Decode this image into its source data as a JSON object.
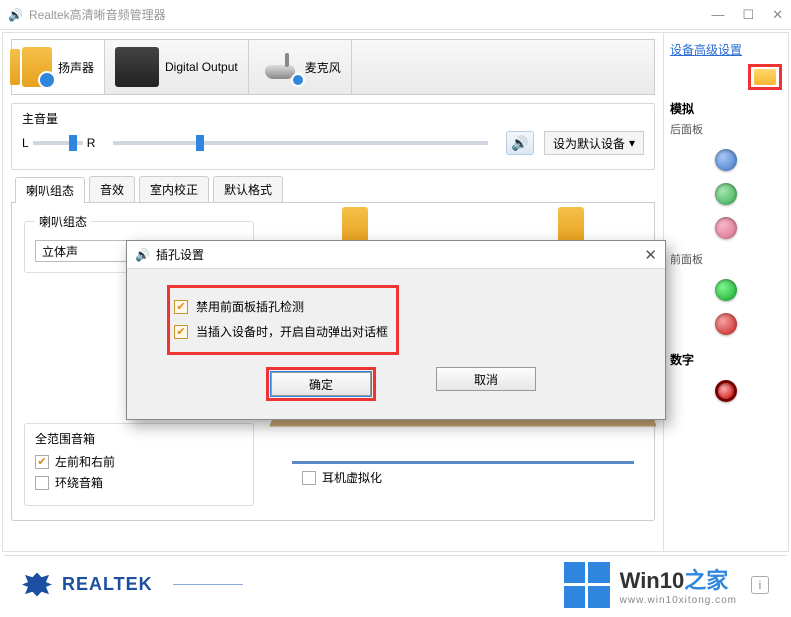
{
  "titlebar": {
    "title": "Realtek高清晰音频管理器"
  },
  "device_tabs": {
    "speaker": "扬声器",
    "digital": "Digital Output",
    "mic": "麦克风"
  },
  "volume": {
    "section_label": "主音量",
    "balance_left": "L",
    "balance_right": "R",
    "default_dropdown": "设为默认设备"
  },
  "inner_tabs": {
    "t1": "喇叭组态",
    "t2": "音效",
    "t3": "室内校正",
    "t4": "默认格式"
  },
  "panel": {
    "spk_config_legend": "喇叭组态",
    "spk_select_value": "立体声",
    "full_range_title": "全范围音箱",
    "full_range_opt1": "左前和右前",
    "full_range_opt2": "环绕音箱",
    "hp_virtual": "耳机虚拟化"
  },
  "sidebar": {
    "advanced_link": "设备高级设置",
    "analog": "模拟",
    "rear": "后面板",
    "front": "前面板",
    "digital": "数字"
  },
  "modal": {
    "title": "插孔设置",
    "opt1": "禁用前面板插孔检测",
    "opt2": "当插入设备时，开启自动弹出对话框",
    "ok": "确定",
    "cancel": "取消"
  },
  "footer": {
    "brand": "REALTEK",
    "win_a": "Win10",
    "win_b": "之家",
    "win_url": "www.win10xitong.com"
  }
}
